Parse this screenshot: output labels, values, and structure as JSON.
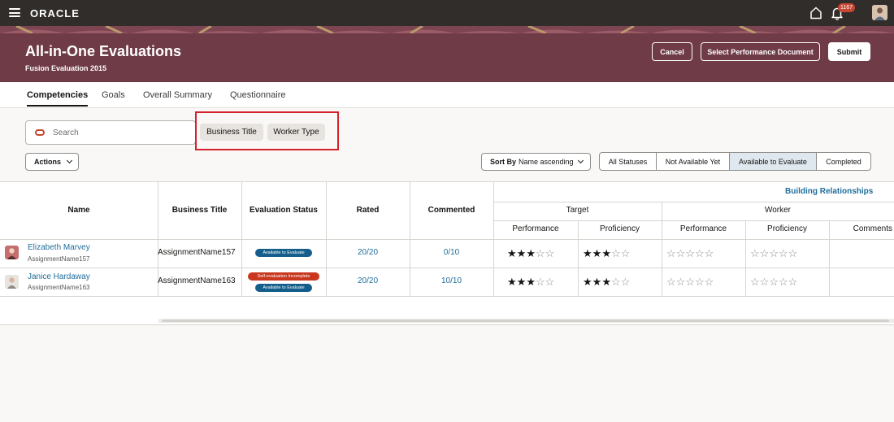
{
  "topbar": {
    "logo": "ORACLE",
    "notification_count": "1167"
  },
  "header": {
    "title": "All-in-One Evaluations",
    "subtitle": "Fusion Evaluation 2015",
    "cancel_label": "Cancel",
    "select_doc_label": "Select Performance Document",
    "submit_label": "Submit"
  },
  "tabs": [
    {
      "label": "Competencies",
      "active": true
    },
    {
      "label": "Goals"
    },
    {
      "label": "Overall Summary"
    },
    {
      "label": "Questionnaire"
    }
  ],
  "search": {
    "placeholder": "Search"
  },
  "filters": {
    "chip1": "Business Title",
    "chip2": "Worker Type"
  },
  "toolbar": {
    "actions_label": "Actions",
    "sort_prefix": "Sort By",
    "sort_value": "Name ascending",
    "statuses": [
      "All Statuses",
      "Not Available Yet",
      "Available to Evaluate",
      "Completed"
    ],
    "selected_status": "Available to Evaluate"
  },
  "table": {
    "section_title": "Building Relationships",
    "headers": {
      "name": "Name",
      "business_title": "Business Title",
      "evaluation_status": "Evaluation Status",
      "rated": "Rated",
      "commented": "Commented",
      "target": "Target",
      "worker": "Worker",
      "performance": "Performance",
      "proficiency": "Proficiency",
      "comments": "Comments"
    },
    "rows": [
      {
        "name": "Elizabeth Marvey",
        "assignment": "AssignmentName157",
        "business_title": "AssignmentName157",
        "statuses": [
          "Available to Evaluate"
        ],
        "rated": "20/20",
        "commented": "0/10",
        "target_performance": 3,
        "target_proficiency": 3,
        "worker_performance": 0,
        "worker_proficiency": 0
      },
      {
        "name": "Janice Hardaway",
        "assignment": "AssignmentName163",
        "business_title": "AssignmentName163",
        "statuses": [
          "Self-evaluation Incomplete",
          "Available to Evaluate"
        ],
        "rated": "20/20",
        "commented": "10/10",
        "target_performance": 3,
        "target_proficiency": 3,
        "worker_performance": 0,
        "worker_proficiency": 0
      }
    ]
  },
  "colors": {
    "banner": "#6f3b47",
    "topbar": "#312d2a",
    "link": "#1f6d9b",
    "badge_blue": "#135e8b",
    "badge_red": "#c8371e",
    "highlight": "#d5212c"
  }
}
